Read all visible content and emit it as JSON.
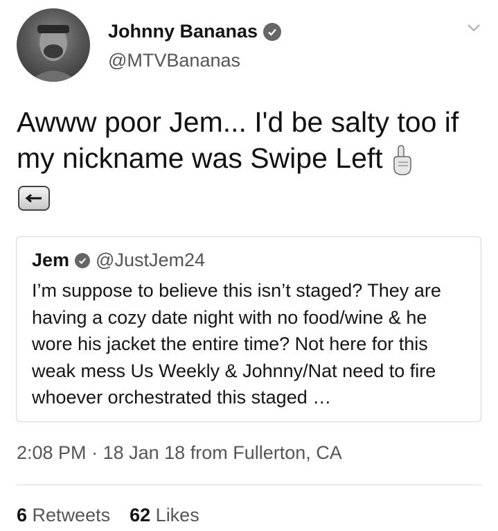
{
  "author": {
    "display_name": "Johnny Bananas",
    "handle": "@MTVBananas",
    "verified_icon": "verified-badge-icon"
  },
  "tweet": {
    "text": "Awww poor Jem... I'd be salty too if my nickname was Swipe Left",
    "emojis": [
      "pointing-up-hand-emoji",
      "back-arrow-emoji"
    ]
  },
  "quoted_tweet": {
    "display_name": "Jem",
    "handle": "@JustJem24",
    "text": "I’m suppose to believe this isn’t staged? They are having a cozy date night with no food/wine & he wore his jacket the entire time? Not here for this weak mess Us Weekly & Johnny/Nat need to fire whoever orchestrated this staged …"
  },
  "meta": {
    "time": "2:08 PM",
    "separator": "·",
    "date": "18 Jan 18",
    "location": "from Fullerton, CA"
  },
  "stats": {
    "retweets_count": "6",
    "retweets_label": "Retweets",
    "likes_count": "62",
    "likes_label": "Likes"
  }
}
